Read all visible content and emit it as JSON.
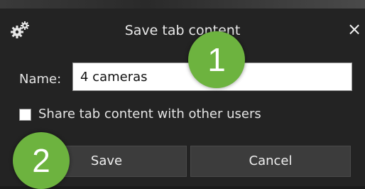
{
  "dialog": {
    "title": "Save tab content",
    "close_label": "×",
    "icon": "gear-icon"
  },
  "form": {
    "name_label": "Name:",
    "name_value": "4 cameras",
    "share_label": "Share tab content with other users",
    "share_checked": false
  },
  "buttons": {
    "save_label": "Save",
    "cancel_label": "Cancel"
  },
  "callouts": {
    "step1": "1",
    "step2": "2"
  },
  "colors": {
    "callout": "#6db33f",
    "dialog_bg": "#232323",
    "button_bg": "#3c3c3c"
  }
}
